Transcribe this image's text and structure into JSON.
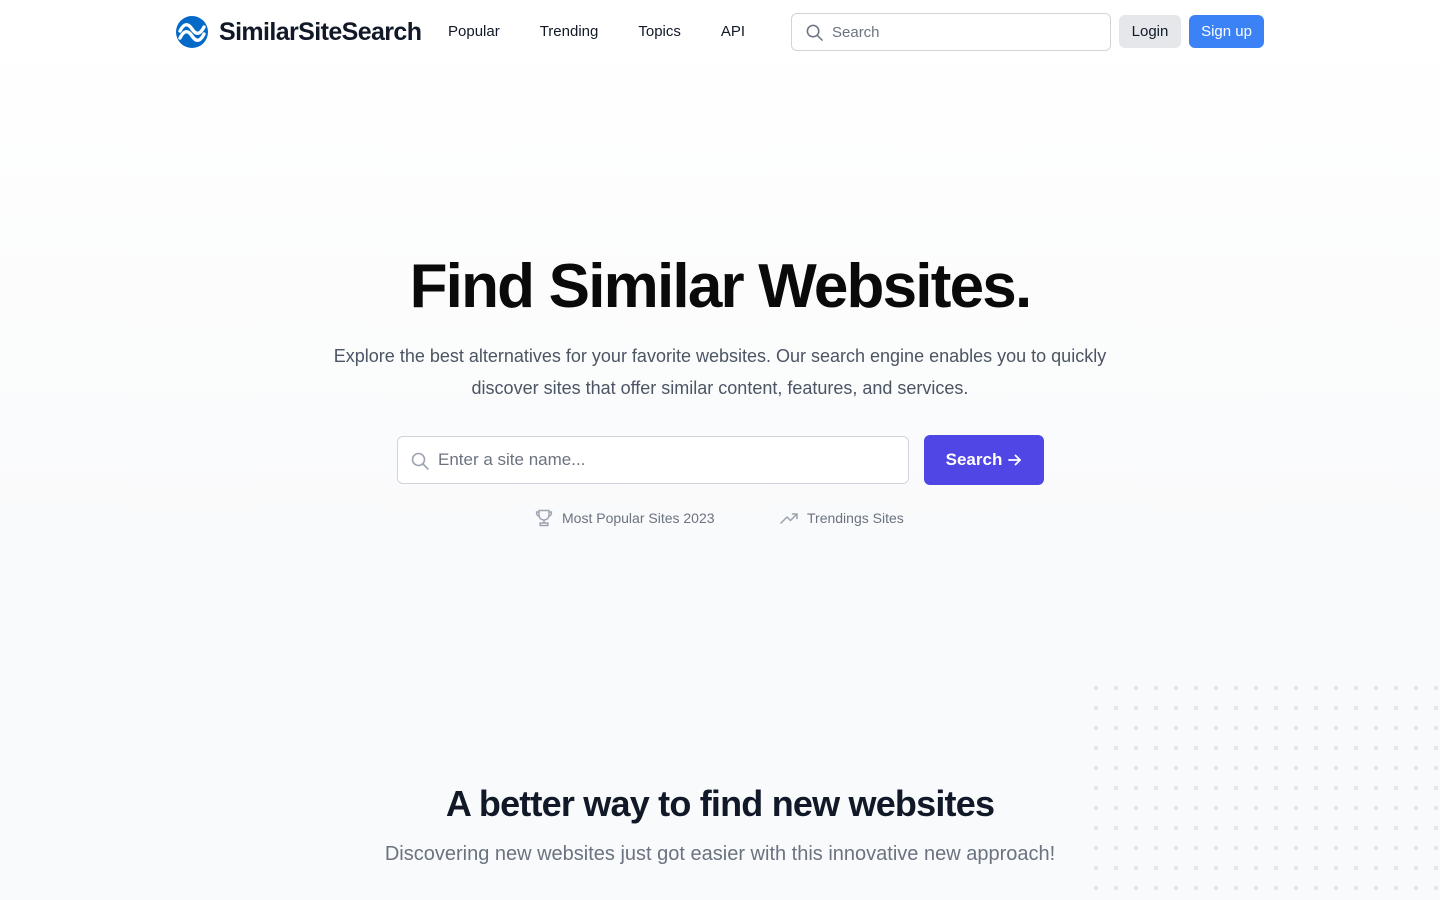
{
  "brand": {
    "name": "SimilarSiteSearch",
    "logo_color": "#0369c9"
  },
  "nav": {
    "items": [
      {
        "label": "Popular"
      },
      {
        "label": "Trending"
      },
      {
        "label": "Topics"
      },
      {
        "label": "API"
      }
    ]
  },
  "header": {
    "search_placeholder": "Search",
    "login_label": "Login",
    "signup_label": "Sign up"
  },
  "hero": {
    "title": "Find Similar Websites.",
    "subtitle": "Explore the best alternatives for your favorite websites. Our search engine enables you to quickly discover sites that offer similar content, features, and services.",
    "search_placeholder": "Enter a site name...",
    "search_button_label": "Search",
    "quick_links": [
      {
        "label": "Most Popular Sites 2023",
        "icon": "trophy-icon"
      },
      {
        "label": "Trendings Sites",
        "icon": "trending-up-icon"
      }
    ]
  },
  "section": {
    "title": "A better way to find new websites",
    "subtitle": "Discovering new websites just got easier with this innovative new approach!"
  },
  "colors": {
    "primary": "#4f46e5",
    "signup": "#3b82f6",
    "login_bg": "#e5e7eb",
    "text_dark": "#111827",
    "text_muted": "#6b7280"
  }
}
